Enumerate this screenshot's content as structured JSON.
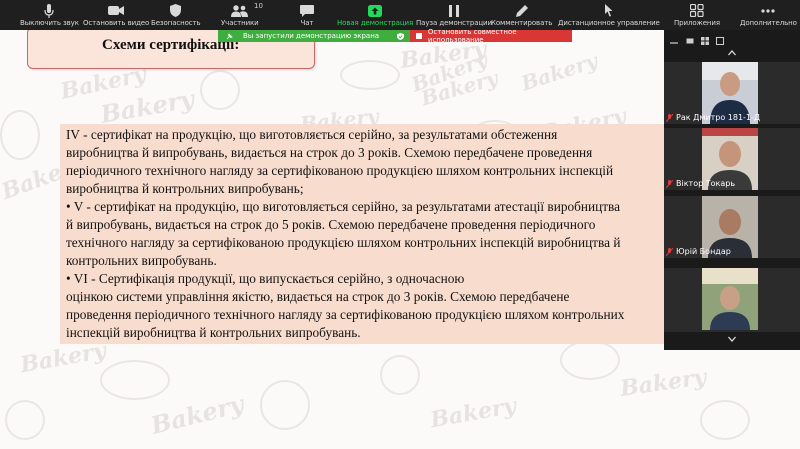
{
  "toolbar": {
    "items": [
      {
        "label": "Выключить звук",
        "icon": "microphone-icon"
      },
      {
        "label": "Остановить видео",
        "icon": "video-camera-icon"
      },
      {
        "label": "Безопасность",
        "icon": "shield-icon"
      },
      {
        "label": "Участники",
        "icon": "participants-icon",
        "count": "10"
      },
      {
        "label": "Чат",
        "icon": "chat-icon"
      },
      {
        "label": "Новая демонстрация",
        "icon": "share-screen-icon"
      },
      {
        "label": "Пауза демонстрации",
        "icon": "pause-icon"
      },
      {
        "label": "Комментировать",
        "icon": "pencil-icon"
      },
      {
        "label": "Дистанционное управление",
        "icon": "remote-control-icon"
      },
      {
        "label": "Приложения",
        "icon": "apps-icon"
      },
      {
        "label": "Дополнительно",
        "icon": "more-icon"
      }
    ],
    "accent_color": "#23d959"
  },
  "share_banner": {
    "status": "Вы запустили демонстрацию экрана",
    "stop": "Остановить совместное использование"
  },
  "slide": {
    "title": "Схеми сертифікації:",
    "doodle_text": "Bakery",
    "lines": [
      " IV - сертифікат на продукцію, що виготовляється серійно, за результатами обстеження",
      "виробництва й випробувань, видається на строк до 3 років. Схемою передбачене проведення",
      "періодичного технічного нагляду за сертифікованою продукцією шляхом контрольних інспекцій",
      "виробництва й контрольних випробувань;",
      "•    V - сертифікат на продукцію, що виготовляється серійно, за результатами атестації виробництва",
      "й випробувань, видається на строк до 5 років. Схемою передбачене проведення періодичного",
      "технічного нагляду за сертифікованою продукцією шляхом контрольних інспекцій виробництва й",
      "контрольних випробувань.",
      "•    VI - Сертифікація продукції, що випускається серійно, з одночасною",
      "оцінкою системи управління якістю, видається на строк до 3 років. Схемою передбачене",
      "проведення періодичного технічного нагляду за сертифікованою продукцією шляхом контрольних",
      "інспекцій виробництва й контрольних випробувань."
    ]
  },
  "gallery": {
    "participants": [
      {
        "name": "Рак Дмитро 181-1-Д"
      },
      {
        "name": "Віктор Токарь"
      },
      {
        "name": "Юрій Бондар"
      },
      {
        "name": ""
      }
    ]
  }
}
